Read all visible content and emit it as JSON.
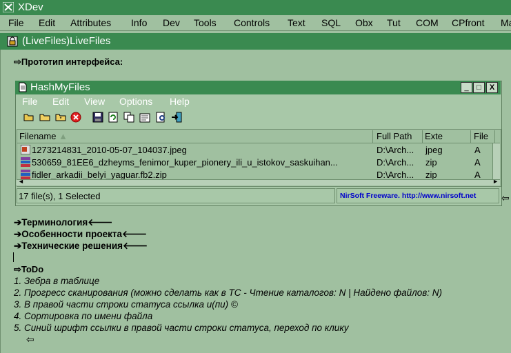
{
  "app": {
    "title": "XDev",
    "menu": [
      "File",
      "Edit",
      "Attributes",
      "Info",
      "Dev",
      "Tools",
      "Controls",
      "Text",
      "SQL",
      "Obx",
      "Tut",
      "COM",
      "CPfront",
      "Ma"
    ]
  },
  "inner_window": {
    "title": "(LiveFiles)LiveFiles"
  },
  "doc": {
    "prototype_label": "⇨Прототип интерфейса:",
    "links": [
      "➔Терминология🡐",
      "➔Особенности проекта🡐",
      "➔Технические решения🡐"
    ],
    "todo_label": "⇨ToDo",
    "todo_items": [
      "1. Зебра в таблице",
      "2. Прогресс сканирования (можно сделать как в TC - Чтение каталогов: N | Найдено файлов: N)",
      "3. В правой части строки статуса ссылка и(пи) ©",
      "4. Сортировка по имени файла",
      "5. Синий шрифт ссылки в правой части строки статуса, переход по клику"
    ],
    "end_arrow": "⇦"
  },
  "hashmyfiles": {
    "title": "HashMyFiles",
    "window_buttons": [
      "_",
      "□",
      "X"
    ],
    "menu": [
      "File",
      "Edit",
      "View",
      "Options",
      "Help"
    ],
    "columns": [
      "Filename",
      "Full Path",
      "Exte",
      "File"
    ],
    "rows": [
      {
        "filename": "1273214831_2010-05-07_104037.jpeg",
        "path": "D:\\Arch...",
        "ext": "jpeg",
        "attr": "A"
      },
      {
        "filename": "530659_81EE6_dzheyms_fenimor_kuper_pionery_ili_u_istokov_saskuihan...",
        "path": "D:\\Arch...",
        "ext": "zip",
        "attr": "A"
      },
      {
        "filename": "fidler_arkadii_belyi_yaguar.fb2.zip",
        "path": "D:\\Arch...",
        "ext": "zip",
        "attr": "A"
      }
    ],
    "status_count": "17 file(s), 1 Selected",
    "status_link": "NirSoft Freeware.  http://www.nirsoft.net",
    "side_arrow": "⇦"
  },
  "colors": {
    "titlebar": "#3a8a50",
    "background": "#a0c0a0",
    "link": "#0000cc"
  }
}
